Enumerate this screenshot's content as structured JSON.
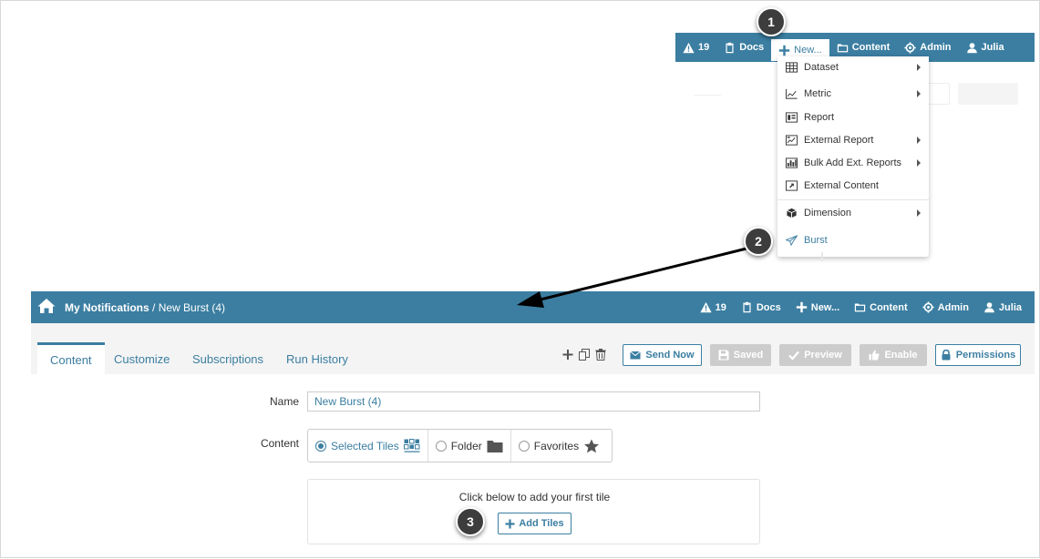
{
  "top_nav": {
    "alerts_count": "19",
    "docs": "Docs",
    "new": "New...",
    "content": "Content",
    "admin": "Admin",
    "user": "Julia"
  },
  "new_menu": {
    "items": [
      {
        "label": "Dataset",
        "icon": "table-icon",
        "submenu": true
      },
      {
        "label": "Metric",
        "icon": "line-chart-icon",
        "submenu": true
      },
      {
        "label": "Report",
        "icon": "report-icon",
        "submenu": false
      },
      {
        "label": "External Report",
        "icon": "external-report-icon",
        "submenu": true
      },
      {
        "label": "Bulk Add Ext. Reports",
        "icon": "bulk-report-icon",
        "submenu": true
      },
      {
        "label": "External Content",
        "icon": "external-content-icon",
        "submenu": false
      },
      {
        "label": "Dimension",
        "icon": "cube-icon",
        "submenu": true
      },
      {
        "label": "Burst",
        "icon": "paper-plane-icon",
        "submenu": false
      }
    ]
  },
  "callouts": [
    "1",
    "2",
    "3"
  ],
  "main_nav": {
    "breadcrumb_root": "My Notifications",
    "breadcrumb_separator": " / ",
    "breadcrumb_current": "New Burst (4)",
    "alerts_count": "19",
    "docs": "Docs",
    "new": "New...",
    "content": "Content",
    "admin": "Admin",
    "user": "Julia"
  },
  "tabs": [
    "Content",
    "Customize",
    "Subscriptions",
    "Run History"
  ],
  "toolbar": {
    "send_now": "Send Now",
    "saved": "Saved",
    "preview": "Preview",
    "enable": "Enable",
    "permissions": "Permissions"
  },
  "form": {
    "name_label": "Name",
    "name_value": "New Burst (4)",
    "content_label": "Content",
    "content_options": [
      "Selected Tiles",
      "Folder",
      "Favorites"
    ],
    "selected_option": "Selected Tiles"
  },
  "tiles": {
    "message": "Click below to add your first tile",
    "add_button": "Add Tiles"
  },
  "colors": {
    "brand": "#3b7ea1",
    "disabled": "#cccccc",
    "callout": "#3d3d3d"
  }
}
